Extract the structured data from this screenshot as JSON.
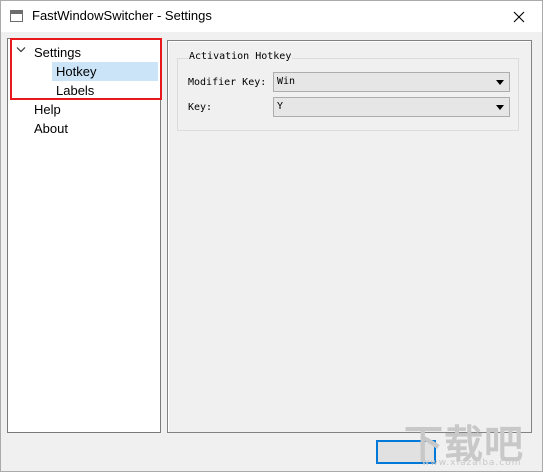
{
  "window": {
    "title": "FastWindowSwitcher - Settings"
  },
  "tree": {
    "items": [
      {
        "label": "Settings",
        "level": 0,
        "expanded": true
      },
      {
        "label": "Hotkey",
        "level": 1,
        "selected": true
      },
      {
        "label": "Labels",
        "level": 1
      },
      {
        "label": "Help",
        "level": 0
      },
      {
        "label": "About",
        "level": 0
      }
    ]
  },
  "activation": {
    "group_title": "Activation Hotkey",
    "modifier_label": "Modifier Key:",
    "modifier_value": "Win",
    "key_label": "Key:",
    "key_value": "Y"
  },
  "dialog": {
    "ok_label": ""
  },
  "watermark": {
    "text": "下载吧",
    "url": "www.xiazaiba.com"
  },
  "colors": {
    "selection": "#cce4f7",
    "highlight_box": "#e8191d",
    "focus_border": "#0078d7"
  },
  "icons": {
    "close": "close-icon",
    "expander": "chevron-down-icon",
    "dropdown": "dropdown-arrow-icon"
  }
}
